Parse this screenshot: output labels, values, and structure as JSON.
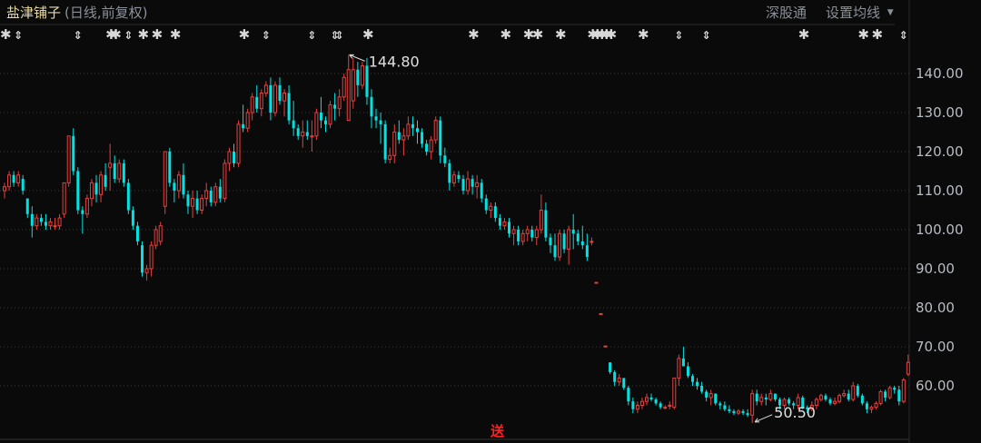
{
  "header": {
    "stock_name": "盐津铺子",
    "subtitle": "(日线,前复权)",
    "hk_connect_label": "深股通",
    "ma_settings_label": "设置均线",
    "dropdown_icon": "caret-down-icon"
  },
  "bottom_marker_text": "送",
  "colors": {
    "up": "#e8403e",
    "down": "#00e3e3",
    "grid": "#3a3a3a",
    "background": "#0a0a0a"
  },
  "chart_data": {
    "type": "candlestick",
    "title": "盐津铺子 (日线,前复权)",
    "ylim": [
      48,
      147
    ],
    "yticks": [
      140,
      130,
      120,
      110,
      100,
      90,
      80,
      70,
      60
    ],
    "ytick_labels": [
      "140.00",
      "130.00",
      "120.00",
      "110.00",
      "100.00",
      "90.00",
      "80.00",
      "70.00",
      "60.00"
    ],
    "grid": true,
    "annotations": [
      {
        "label": "144.80",
        "value": 144.8,
        "index": 75,
        "kind": "high"
      },
      {
        "label": "50.50",
        "value": 50.5,
        "index": 163,
        "kind": "low"
      }
    ],
    "event_markers": [
      {
        "index": 0,
        "type": "star"
      },
      {
        "index": 3,
        "type": "arrow"
      },
      {
        "index": 16,
        "type": "arrow"
      },
      {
        "index": 23,
        "type": "star"
      },
      {
        "index": 24,
        "type": "star"
      },
      {
        "index": 27,
        "type": "arrow"
      },
      {
        "index": 30,
        "type": "star"
      },
      {
        "index": 33,
        "type": "star"
      },
      {
        "index": 37,
        "type": "star"
      },
      {
        "index": 52,
        "type": "star"
      },
      {
        "index": 57,
        "type": "arrow"
      },
      {
        "index": 67,
        "type": "arrow"
      },
      {
        "index": 72,
        "type": "arrow"
      },
      {
        "index": 73,
        "type": "arrow"
      },
      {
        "index": 79,
        "type": "star"
      },
      {
        "index": 102,
        "type": "star"
      },
      {
        "index": 109,
        "type": "star"
      },
      {
        "index": 114,
        "type": "star"
      },
      {
        "index": 116,
        "type": "star"
      },
      {
        "index": 121,
        "type": "star"
      },
      {
        "index": 128,
        "type": "star"
      },
      {
        "index": 129,
        "type": "star"
      },
      {
        "index": 130,
        "type": "star"
      },
      {
        "index": 131,
        "type": "star"
      },
      {
        "index": 132,
        "type": "star"
      },
      {
        "index": 139,
        "type": "star"
      },
      {
        "index": 147,
        "type": "arrow"
      },
      {
        "index": 153,
        "type": "arrow"
      },
      {
        "index": 174,
        "type": "star"
      },
      {
        "index": 187,
        "type": "star"
      },
      {
        "index": 190,
        "type": "star"
      },
      {
        "index": 196,
        "type": "arrow"
      }
    ],
    "ohlc_format": [
      "open",
      "high",
      "low",
      "close"
    ],
    "candles": [
      [
        110,
        112,
        108,
        111
      ],
      [
        111,
        115,
        110,
        114
      ],
      [
        114,
        115,
        111,
        112
      ],
      [
        112,
        115,
        111,
        114
      ],
      [
        113,
        114,
        109,
        110
      ],
      [
        108,
        108,
        103,
        104
      ],
      [
        104,
        106,
        98,
        101
      ],
      [
        101,
        104,
        100,
        103
      ],
      [
        103,
        104,
        101,
        102
      ],
      [
        102,
        104,
        100,
        101
      ],
      [
        101,
        103,
        100,
        102
      ],
      [
        101,
        103,
        100,
        101
      ],
      [
        101,
        104,
        100,
        103
      ],
      [
        104,
        112,
        103,
        112
      ],
      [
        112,
        124,
        111,
        124
      ],
      [
        124,
        126,
        114,
        115
      ],
      [
        115,
        116,
        104,
        105
      ],
      [
        105,
        106,
        99,
        104
      ],
      [
        104,
        109,
        103,
        108
      ],
      [
        108,
        113,
        106,
        112
      ],
      [
        112,
        114,
        107,
        109
      ],
      [
        109,
        115,
        107,
        114
      ],
      [
        114,
        117,
        110,
        111
      ],
      [
        116,
        122,
        110,
        117
      ],
      [
        117,
        119,
        112,
        113
      ],
      [
        113,
        118,
        112,
        117
      ],
      [
        117,
        118,
        111,
        112
      ],
      [
        112,
        113,
        104,
        105
      ],
      [
        105,
        106,
        100,
        101
      ],
      [
        101,
        102,
        96,
        97
      ],
      [
        96,
        97,
        88,
        89
      ],
      [
        89,
        91,
        87,
        90
      ],
      [
        90,
        97,
        88,
        96
      ],
      [
        96,
        101,
        95,
        100
      ],
      [
        97,
        102,
        96,
        101
      ],
      [
        106,
        120,
        104,
        120
      ],
      [
        120,
        121,
        111,
        112
      ],
      [
        112,
        113,
        107,
        110
      ],
      [
        110,
        115,
        108,
        114
      ],
      [
        114,
        117,
        108,
        109
      ],
      [
        109,
        110,
        104,
        106
      ],
      [
        106,
        110,
        103,
        108
      ],
      [
        108,
        110,
        104,
        105
      ],
      [
        105,
        109,
        104,
        108
      ],
      [
        108,
        112,
        106,
        110
      ],
      [
        110,
        111,
        106,
        107
      ],
      [
        107,
        112,
        106,
        111
      ],
      [
        111,
        113,
        107,
        108
      ],
      [
        108,
        118,
        107,
        117
      ],
      [
        117,
        121,
        115,
        120
      ],
      [
        120,
        122,
        116,
        117
      ],
      [
        117,
        128,
        116,
        127
      ],
      [
        127,
        132,
        125,
        126
      ],
      [
        126,
        131,
        125,
        130
      ],
      [
        130,
        135,
        128,
        134
      ],
      [
        134,
        137,
        130,
        131
      ],
      [
        131,
        136,
        129,
        135
      ],
      [
        135,
        138,
        134,
        137
      ],
      [
        137,
        139,
        128,
        130
      ],
      [
        130,
        138,
        129,
        137
      ],
      [
        137,
        139,
        132,
        133
      ],
      [
        133,
        136,
        129,
        135
      ],
      [
        135,
        137,
        127,
        128
      ],
      [
        128,
        133,
        124,
        126
      ],
      [
        126,
        127,
        123,
        124
      ],
      [
        124,
        128,
        121,
        125
      ],
      [
        125,
        128,
        123,
        124
      ],
      [
        124,
        128,
        120,
        124
      ],
      [
        124,
        131,
        123,
        130
      ],
      [
        130,
        134,
        126,
        128
      ],
      [
        128,
        129,
        125,
        127
      ],
      [
        127,
        133,
        126,
        132
      ],
      [
        132,
        135,
        128,
        131
      ],
      [
        131,
        136,
        129,
        134
      ],
      [
        134,
        140,
        133,
        139
      ],
      [
        128,
        144.8,
        128,
        141
      ],
      [
        133,
        144,
        131,
        141
      ],
      [
        141,
        143,
        134,
        137
      ],
      [
        137,
        143,
        136,
        142
      ],
      [
        142,
        144,
        132,
        134
      ],
      [
        134,
        136,
        126,
        129
      ],
      [
        129,
        131,
        126,
        128
      ],
      [
        128,
        130,
        122,
        127
      ],
      [
        127,
        128,
        117,
        118
      ],
      [
        118,
        121,
        117,
        119
      ],
      [
        119,
        127,
        117,
        125
      ],
      [
        125,
        128,
        122,
        123
      ],
      [
        123,
        126,
        119,
        124
      ],
      [
        124,
        129,
        123,
        127
      ],
      [
        127,
        129,
        124,
        126
      ],
      [
        126,
        128,
        122,
        125
      ],
      [
        125,
        126,
        121,
        122
      ],
      [
        122,
        123,
        119,
        120
      ],
      [
        120,
        124,
        118,
        123
      ],
      [
        123,
        129,
        122,
        128
      ],
      [
        128,
        129,
        117,
        119
      ],
      [
        119,
        121,
        116,
        117
      ],
      [
        117,
        118,
        110,
        112
      ],
      [
        112,
        115,
        111,
        114
      ],
      [
        114,
        115,
        112,
        113
      ],
      [
        113,
        114,
        109,
        110
      ],
      [
        110,
        115,
        109,
        113
      ],
      [
        113,
        114,
        109,
        111
      ],
      [
        111,
        114,
        108,
        112
      ],
      [
        112,
        113,
        107,
        108
      ],
      [
        108,
        109,
        104,
        105
      ],
      [
        105,
        107,
        103,
        106
      ],
      [
        106,
        107,
        102,
        103
      ],
      [
        103,
        104,
        100,
        101
      ],
      [
        101,
        103,
        100,
        102
      ],
      [
        102,
        103,
        98,
        99
      ],
      [
        99,
        101,
        96,
        100
      ],
      [
        100,
        101,
        96,
        97
      ],
      [
        97,
        100,
        96,
        99
      ],
      [
        99,
        101,
        97,
        100
      ],
      [
        100,
        101,
        97,
        98
      ],
      [
        98,
        101,
        96,
        100
      ],
      [
        100,
        109,
        99,
        105
      ],
      [
        105,
        107,
        97,
        98
      ],
      [
        98,
        99,
        94,
        96
      ],
      [
        96,
        99,
        92,
        93
      ],
      [
        93,
        100,
        92,
        99
      ],
      [
        99,
        100,
        94,
        95
      ],
      [
        95,
        101,
        91,
        100
      ],
      [
        100,
        104,
        95,
        99
      ],
      [
        99,
        100,
        96,
        97
      ],
      [
        97,
        101,
        95,
        96
      ],
      [
        96,
        99,
        92,
        93
      ],
      [
        97,
        98,
        96,
        97
      ],
      [
        86.5,
        86.5,
        86.5,
        86.5
      ],
      [
        78.5,
        78.5,
        78.5,
        78.5
      ],
      [
        70.2,
        70.2,
        70.2,
        70.2
      ],
      [
        66,
        66,
        63,
        63.5
      ],
      [
        63.5,
        64,
        60,
        61
      ],
      [
        61,
        63,
        60,
        62
      ],
      [
        62,
        62,
        59,
        59.5
      ],
      [
        59.5,
        60,
        55,
        56
      ],
      [
        56,
        57,
        53,
        54
      ],
      [
        54,
        56,
        53,
        55
      ],
      [
        55,
        57,
        54,
        56
      ],
      [
        56,
        58,
        55,
        57
      ],
      [
        57,
        58,
        56,
        56.5
      ],
      [
        56.5,
        57,
        55,
        55.5
      ],
      [
        55.5,
        56,
        54,
        54.5
      ],
      [
        54.5,
        55,
        54,
        54.5
      ],
      [
        55,
        56,
        54,
        55
      ],
      [
        54.5,
        62,
        54,
        62
      ],
      [
        62,
        68,
        60,
        67
      ],
      [
        67,
        70,
        65,
        65
      ],
      [
        65,
        66,
        62,
        62.5
      ],
      [
        62.5,
        63,
        60,
        61
      ],
      [
        61,
        62,
        59,
        60
      ],
      [
        60,
        61,
        58,
        58.5
      ],
      [
        58.5,
        59,
        56,
        57
      ],
      [
        57,
        59,
        55,
        58
      ],
      [
        58,
        58,
        55,
        55.5
      ],
      [
        55.5,
        56,
        54,
        55
      ],
      [
        55,
        56,
        53.5,
        54
      ],
      [
        54,
        55,
        53,
        53.5
      ],
      [
        53.5,
        54,
        52.5,
        53
      ],
      [
        53,
        54,
        52.5,
        53.5
      ],
      [
        53.5,
        54,
        52.5,
        53
      ],
      [
        53,
        54,
        52,
        52.5
      ],
      [
        52.5,
        59,
        50.5,
        58
      ],
      [
        58,
        59,
        55,
        56
      ],
      [
        56,
        58,
        55,
        57
      ],
      [
        57,
        58,
        55,
        56.5
      ],
      [
        56.5,
        59,
        56,
        58
      ],
      [
        58,
        58,
        56,
        56.5
      ],
      [
        56.5,
        57,
        54,
        55
      ],
      [
        55,
        57,
        54,
        56.5
      ],
      [
        56.5,
        57,
        55,
        55.5
      ],
      [
        55.5,
        56,
        54,
        55
      ],
      [
        55,
        58,
        54,
        57
      ],
      [
        57,
        57.5,
        54,
        54.5
      ],
      [
        54.5,
        55,
        53,
        54
      ],
      [
        54,
        56,
        53.5,
        55
      ],
      [
        55,
        57,
        54,
        56.5
      ],
      [
        56.5,
        58,
        56,
        57.5
      ],
      [
        57.5,
        58,
        56,
        56.5
      ],
      [
        56.5,
        57,
        55,
        55.5
      ],
      [
        55.5,
        57,
        55,
        56
      ],
      [
        56,
        58,
        55.5,
        57.5
      ],
      [
        57.5,
        59,
        57,
        58
      ],
      [
        58,
        59,
        56,
        56.5
      ],
      [
        56.5,
        61,
        56,
        60
      ],
      [
        60,
        60.5,
        57,
        57.5
      ],
      [
        57.5,
        58,
        55,
        55.5
      ],
      [
        55.5,
        56,
        53,
        54
      ],
      [
        54,
        55,
        53,
        54.5
      ],
      [
        54.5,
        56,
        54,
        55.5
      ],
      [
        55.5,
        59,
        55,
        58.5
      ],
      [
        58.5,
        59,
        56,
        57
      ],
      [
        57,
        60,
        56.5,
        59.5
      ],
      [
        59.5,
        60,
        58,
        59
      ],
      [
        59,
        60,
        55,
        56
      ],
      [
        56,
        62,
        55.5,
        61.5
      ],
      [
        63,
        68,
        62.5,
        66
      ]
    ]
  }
}
